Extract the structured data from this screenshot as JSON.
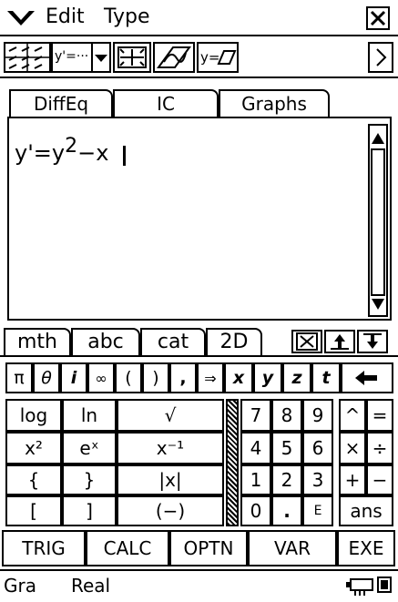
{
  "menu": {
    "edit": "Edit",
    "type": "Type",
    "close": "×"
  },
  "tabs": [
    "DiffEq",
    "IC",
    "Graphs"
  ],
  "editor": {
    "equation_base": "y'=y",
    "equation_exp": "2",
    "equation_tail": "−x"
  },
  "kb_tabs": [
    "mth",
    "abc",
    "cat",
    "2D"
  ],
  "keypad_top": [
    "π",
    "θ",
    "i",
    "∞",
    "(",
    ")",
    ",",
    "⇒",
    "x",
    "y",
    "z",
    "t",
    "←"
  ],
  "keypad_left": [
    [
      "log",
      "ln",
      "√"
    ],
    [
      "x²",
      "eˣ",
      "x⁻¹"
    ],
    [
      "{",
      "}",
      "|x|"
    ],
    [
      "[",
      "]",
      "(−)"
    ]
  ],
  "keypad_num": [
    [
      "7",
      "8",
      "9"
    ],
    [
      "4",
      "5",
      "6"
    ],
    [
      "1",
      "2",
      "3"
    ],
    [
      "0",
      ".",
      "E"
    ]
  ],
  "keypad_ops": [
    [
      "^",
      "="
    ],
    [
      "×",
      "÷"
    ],
    [
      "+",
      "−"
    ]
  ],
  "keypad_ans": "ans",
  "soft": [
    "TRIG",
    "CALC",
    "OPTN",
    "VAR",
    "EXE"
  ],
  "status": {
    "mode1": "Gra",
    "mode2": "Real"
  }
}
